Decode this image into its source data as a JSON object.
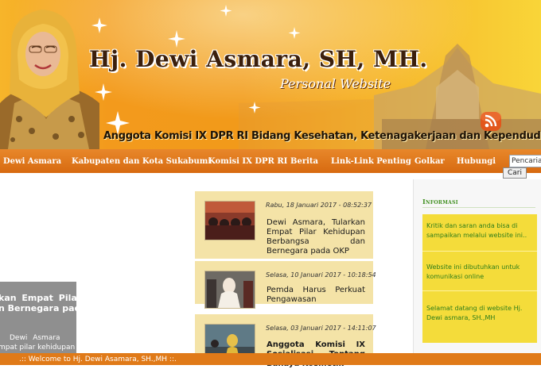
{
  "header": {
    "title": "Hj. Dewi Asmara, SH, MH.",
    "subtitle": "Personal Website",
    "tagline": "Anggota Komisi IX DPR RI Bidang Kesehatan, Ketenagakerjaan dan Kependudukan."
  },
  "nav": {
    "items": [
      "Dewi Asmara",
      "Kabupaten dan Kota Sukabumi",
      "Komisi IX DPR RI",
      "Berita",
      "Link-Link Penting",
      "Golkar",
      "Hubungi"
    ]
  },
  "search": {
    "value": "Pencaria",
    "button_label": "Cari"
  },
  "slider": {
    "title_line1": "kan  Empat  Pilar",
    "title_line2": "n Bernegara pada",
    "snippet_line1": "Dewi       Asmara",
    "snippet_line2": "mpat pilar  kehidupan"
  },
  "news": [
    {
      "date": "Rabu, 18 Januari 2017 - 08:52:37",
      "title": "Dewi Asmara, Tularkan Empat Pilar Kehidupan Berbangsa dan Bernegara pada OKP"
    },
    {
      "date": "Selasa, 10 Januari 2017 - 10:18:54",
      "title": "Pemda Harus Perkuat Pengawasan"
    },
    {
      "date": "Selasa, 03 Januari 2017 - 14:11:07",
      "title": "Anggota Komisi IX Sosialisasi Tentang Bahaya Kosmetik"
    }
  ],
  "sidebar": {
    "heading": "Informasi",
    "messages": [
      "Kritik dan saran anda bisa di sampaikan melalui website ini..",
      "Website ini dibutuhkan untuk komunikasi online",
      "Selamat datang di website Hj. Dewi asmara, SH.,MH"
    ]
  },
  "footer": {
    "marquee": ".:: Welcome to Hj. Dewi Asamara, SH.,MH ::."
  },
  "colors": {
    "nav_bg": "#d76a10",
    "info_box": "#f4dc3a",
    "info_text": "#2e7d1a",
    "news_card": "#f4e3a7"
  }
}
